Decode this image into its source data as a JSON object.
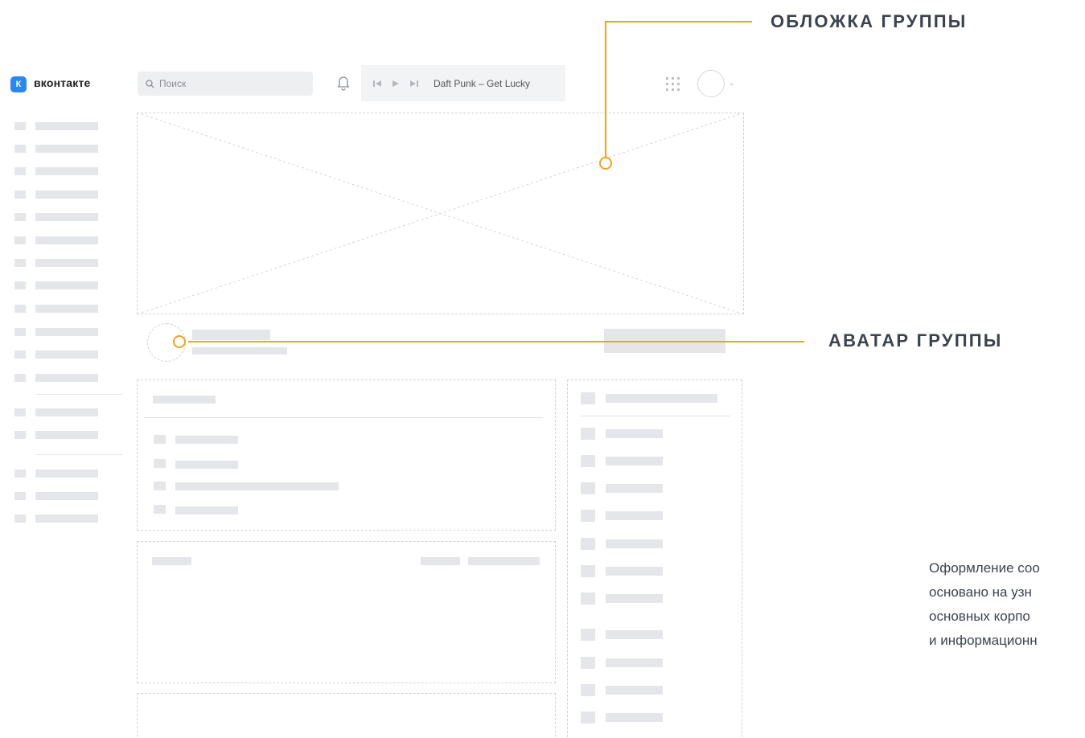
{
  "header": {
    "logo_mark": "К",
    "logo_text": "вконтакте",
    "search_placeholder": "Поиск",
    "player": {
      "prev_icon": "skip-previous-icon",
      "play_icon": "play-icon",
      "next_icon": "skip-next-icon",
      "track": "Daft Punk – Get Lucky"
    }
  },
  "annotations": {
    "cover_label": "ОБЛОЖКА ГРУППЫ",
    "avatar_label": "АВАТАР ГРУППЫ"
  },
  "description": {
    "lines": [
      "Оформление соо",
      "основано на узн",
      "основных корпо",
      "и информационн"
    ]
  },
  "colors": {
    "accent_orange": "#f2a31b",
    "vk_blue": "#2787f5",
    "placeholder_gray": "#e4e6e9",
    "heading_text": "#3b4350"
  }
}
